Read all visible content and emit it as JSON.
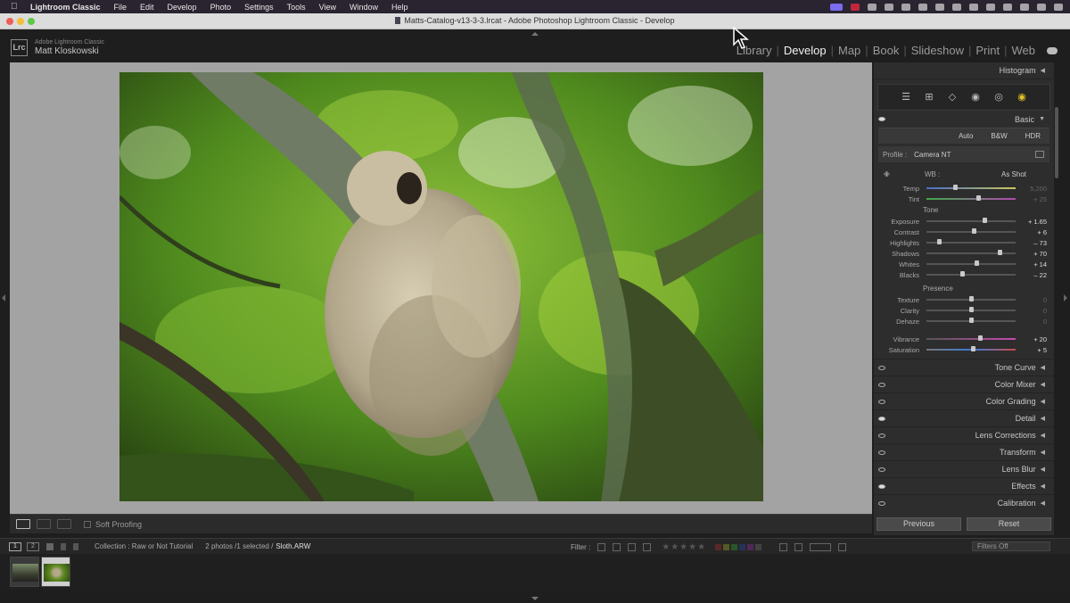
{
  "menubar": {
    "app": "Lightroom Classic",
    "items": [
      "File",
      "Edit",
      "Develop",
      "Photo",
      "Settings",
      "Tools",
      "View",
      "Window",
      "Help"
    ]
  },
  "window": {
    "title": "Matts-Catalog-v13-3-3.lrcat - Adobe Photoshop Lightroom Classic - Develop"
  },
  "identity": {
    "logo": "Lrc",
    "product": "Adobe Lightroom Classic",
    "user": "Matt Kloskowski"
  },
  "modules": [
    "Library",
    "Develop",
    "Map",
    "Book",
    "Slideshow",
    "Print",
    "Web"
  ],
  "active_module": "Develop",
  "toolbar": {
    "soft_proofing": "Soft Proofing"
  },
  "right_panel": {
    "histogram": "Histogram",
    "basic": "Basic",
    "treatment": [
      "Auto",
      "B&W",
      "HDR"
    ],
    "profile_label": "Profile :",
    "profile_value": "Camera NT",
    "wb_label": "WB :",
    "wb_value": "As Shot",
    "temp": {
      "label": "Temp",
      "value": "5,200",
      "pos": 0.32
    },
    "tint": {
      "label": "Tint",
      "value": "+ 25",
      "pos": 0.58
    },
    "tone_label": "Tone",
    "tone_sliders": [
      {
        "label": "Exposure",
        "value": "+ 1.65",
        "pos": 0.65
      },
      {
        "label": "Contrast",
        "value": "+ 6",
        "pos": 0.53
      },
      {
        "label": "Highlights",
        "value": "– 73",
        "pos": 0.14
      },
      {
        "label": "Shadows",
        "value": "+ 70",
        "pos": 0.82
      },
      {
        "label": "Whites",
        "value": "+ 14",
        "pos": 0.56
      },
      {
        "label": "Blacks",
        "value": "– 22",
        "pos": 0.4
      }
    ],
    "presence_label": "Presence",
    "presence_sliders": [
      {
        "label": "Texture",
        "value": "0",
        "pos": 0.5
      },
      {
        "label": "Clarity",
        "value": "0",
        "pos": 0.5
      },
      {
        "label": "Dehaze",
        "value": "0",
        "pos": 0.5
      }
    ],
    "color_sliders": [
      {
        "label": "Vibrance",
        "value": "+ 20",
        "pos": 0.6
      },
      {
        "label": "Saturation",
        "value": "+ 5",
        "pos": 0.52
      }
    ],
    "panels": [
      "Tone Curve",
      "Color Mixer",
      "Color Grading",
      "Detail",
      "Lens Corrections",
      "Transform",
      "Lens Blur",
      "Effects",
      "Calibration"
    ],
    "previous_button": "Previous",
    "reset_button": "Reset"
  },
  "filmstrip_bar": {
    "screen1": "1",
    "screen2": "2",
    "collection": "Collection : Raw or Not Tutorial",
    "count": "2 photos /1 selected /",
    "filename": "Sloth.ARW",
    "filter_label": "Filter :",
    "filters_off": "Filters Off"
  },
  "colors": {
    "accent": "#e0c12a",
    "panel_bg": "#2d2d2d",
    "canvas_bg": "#a3a3a3"
  }
}
